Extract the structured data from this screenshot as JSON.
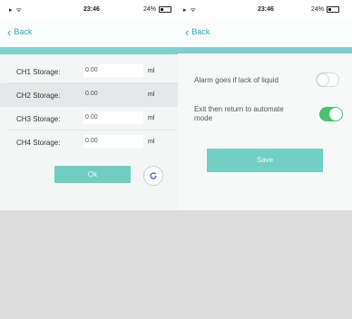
{
  "left_screen": {
    "status": {
      "signal": "▸ ᯤ",
      "time": "23:46",
      "battery": "24%"
    },
    "back_label": "Back",
    "rows": [
      {
        "label": "CH1 Storage:",
        "value": "0.00",
        "unit": "ml"
      },
      {
        "label": "CH2 Storage:",
        "value": "0.00",
        "unit": "ml"
      },
      {
        "label": "CH3 Storage:",
        "value": "0.00",
        "unit": "ml"
      },
      {
        "label": "CH4 Storage:",
        "value": "0.00",
        "unit": "ml"
      }
    ],
    "ok_label": "Ok"
  },
  "right_screen": {
    "status": {
      "signal": "▸ ᯤ",
      "time": "23:46",
      "battery": "24%"
    },
    "back_label": "Back",
    "options": [
      {
        "label": "Alarm goes if lack of liquid",
        "state": "off"
      },
      {
        "label": "Exit then return to automate mode",
        "state": "on"
      }
    ],
    "save_label": "Save"
  },
  "colors": {
    "accent": "#7fcfcb",
    "button": "#6fcdc2",
    "toggle_on": "#48c26b",
    "back_link": "#35a7b5"
  },
  "icons": {
    "refresh": "refresh-icon",
    "back": "chevron-left-icon"
  }
}
